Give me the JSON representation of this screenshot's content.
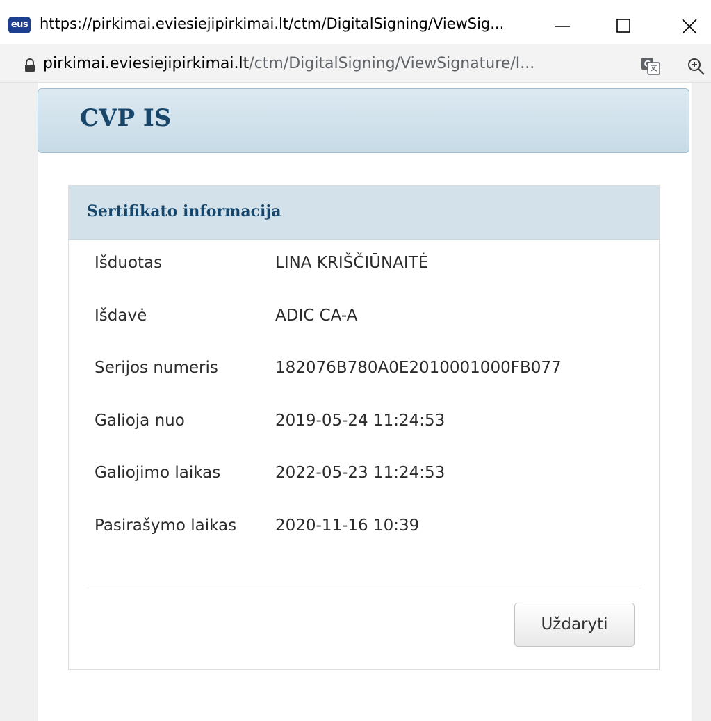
{
  "window": {
    "app_icon_text": "eus",
    "title": "https://pirkimai.eviesiejipirkimai.lt/ctm/DigitalSigning/ViewSig..."
  },
  "addressbar": {
    "host": "pirkimai.eviesiejipirkimai.lt",
    "path": "/ctm/DigitalSigning/ViewSignature/I..."
  },
  "header": {
    "brand": "CVP IS"
  },
  "panel": {
    "title": "Sertifikato informacija",
    "rows": [
      {
        "label": "Išduotas",
        "value": "LINA KRIŠČIŪNAITĖ"
      },
      {
        "label": "Išdavė",
        "value": "ADIC CA-A"
      },
      {
        "label": "Serijos numeris",
        "value": "182076B780A0E2010001000FB077"
      },
      {
        "label": "Galioja nuo",
        "value": "2019-05-24 11:24:53"
      },
      {
        "label": "Galiojimo laikas",
        "value": "2022-05-23 11:24:53"
      },
      {
        "label": "Pasirašymo laikas",
        "value": "2020-11-16 10:39"
      }
    ],
    "close_label": "Uždaryti"
  },
  "icons": {
    "app": "eus-app-icon",
    "minimize": "minimize-icon",
    "maximize": "maximize-icon",
    "close": "close-icon",
    "lock": "lock-icon",
    "translate": "translate-icon",
    "zoom": "zoom-in-icon"
  },
  "colors": {
    "brand_text": "#17466a",
    "banner_bg": "#d2e1ea"
  }
}
